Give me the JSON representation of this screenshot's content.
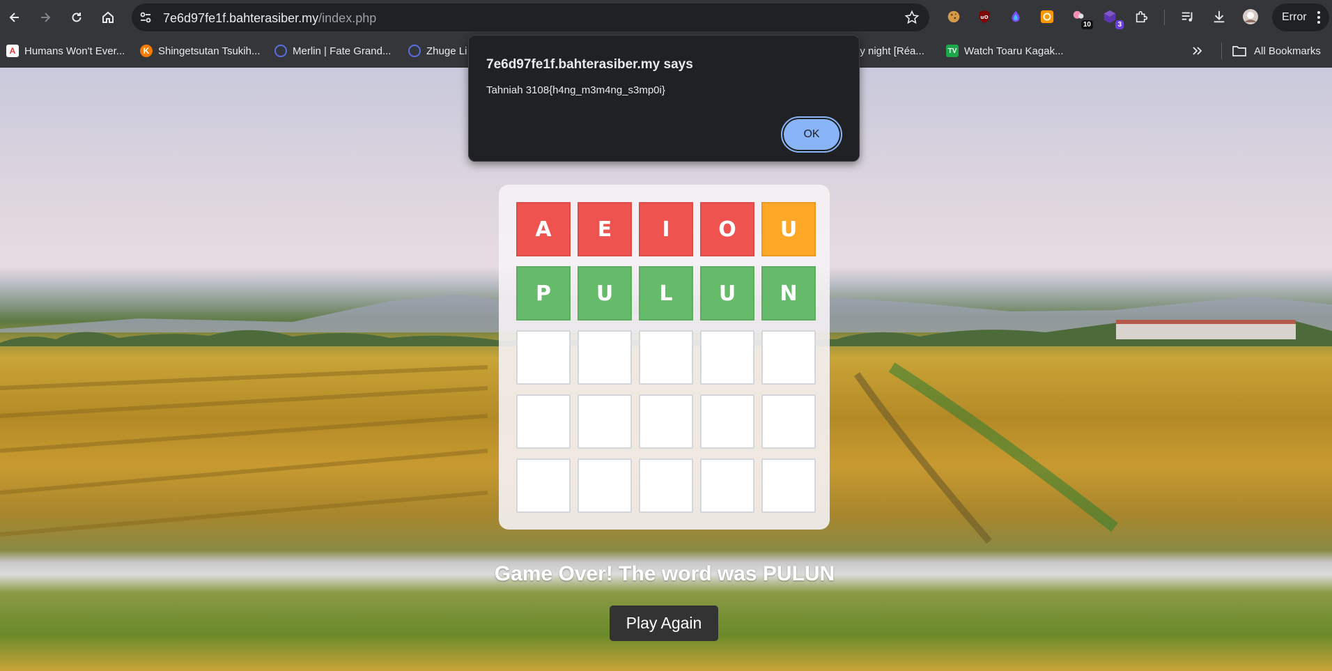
{
  "browser": {
    "url_host": "7e6d97fe1f.bahterasiber.my",
    "url_path": "/index.php",
    "profile_label": "Error",
    "extension_badges": [
      "10",
      "3"
    ],
    "bookmarks": [
      {
        "label": "Humans Won't Ever...",
        "icon": "adobe-icon",
        "color": "#e53935"
      },
      {
        "label": "Shingetsutan Tsukih...",
        "icon": "kitsu-icon",
        "color": "#f57c00"
      },
      {
        "label": "Merlin | Fate Grand...",
        "icon": "fandom-icon",
        "color": "#5b6ee1"
      },
      {
        "label": "Zhuge Li",
        "icon": "fandom-icon",
        "color": "#5b6ee1"
      },
      {
        "label": "ay night [Réa...",
        "icon": "",
        "color": ""
      },
      {
        "label": "Watch Toaru Kagak...",
        "icon": "tv-icon",
        "color": "#1ea64b"
      }
    ],
    "all_bookmarks_label": "All Bookmarks"
  },
  "dialog": {
    "title": "7e6d97fe1f.bahterasiber.my says",
    "message": "Tahniah 3108{h4ng_m3m4ng_s3mp0i}",
    "ok_label": "OK"
  },
  "game": {
    "colors": {
      "absent": "#ef5350",
      "present": "#ffa726",
      "correct": "#66bb6a",
      "empty": "#ffffff"
    },
    "rows": [
      [
        {
          "letter": "A",
          "state": "absent"
        },
        {
          "letter": "E",
          "state": "absent"
        },
        {
          "letter": "I",
          "state": "absent"
        },
        {
          "letter": "O",
          "state": "absent"
        },
        {
          "letter": "U",
          "state": "present"
        }
      ],
      [
        {
          "letter": "P",
          "state": "correct"
        },
        {
          "letter": "U",
          "state": "correct"
        },
        {
          "letter": "L",
          "state": "correct"
        },
        {
          "letter": "U",
          "state": "correct"
        },
        {
          "letter": "N",
          "state": "correct"
        }
      ],
      [
        {
          "letter": "",
          "state": "empty"
        },
        {
          "letter": "",
          "state": "empty"
        },
        {
          "letter": "",
          "state": "empty"
        },
        {
          "letter": "",
          "state": "empty"
        },
        {
          "letter": "",
          "state": "empty"
        }
      ],
      [
        {
          "letter": "",
          "state": "empty"
        },
        {
          "letter": "",
          "state": "empty"
        },
        {
          "letter": "",
          "state": "empty"
        },
        {
          "letter": "",
          "state": "empty"
        },
        {
          "letter": "",
          "state": "empty"
        }
      ],
      [
        {
          "letter": "",
          "state": "empty"
        },
        {
          "letter": "",
          "state": "empty"
        },
        {
          "letter": "",
          "state": "empty"
        },
        {
          "letter": "",
          "state": "empty"
        },
        {
          "letter": "",
          "state": "empty"
        }
      ]
    ],
    "status_message": "Game Over! The word was PULUN",
    "play_again_label": "Play Again"
  }
}
